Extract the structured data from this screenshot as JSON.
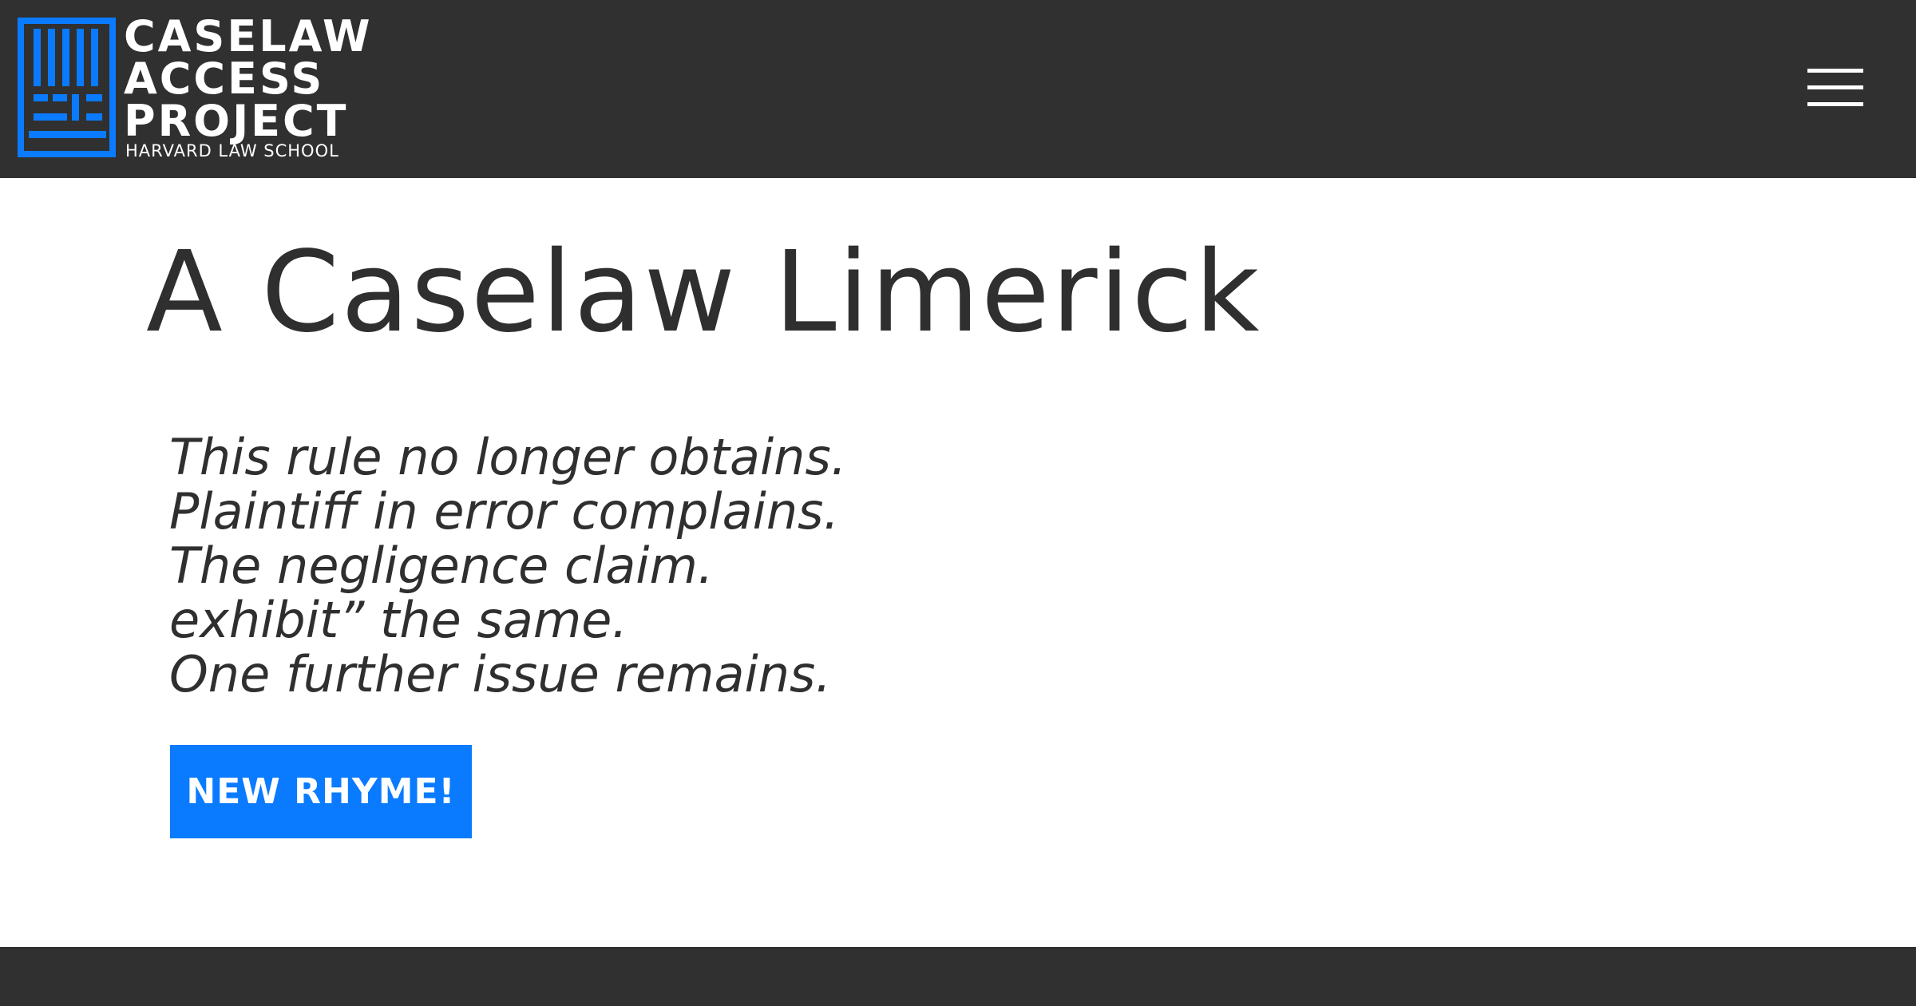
{
  "header": {
    "brand": {
      "line1": "CASELAW",
      "line2": "ACCESS",
      "line3": "PROJECT",
      "subtitle": "HARVARD LAW SCHOOL",
      "logo_icon": "cap-logo-icon",
      "logo_color": "#0a7bff"
    },
    "menu_icon": "hamburger-menu-icon",
    "background_color": "#303030"
  },
  "main": {
    "title": "A Caselaw Limerick",
    "poem": [
      "This rule no longer obtains.",
      "Plaintiff in error complains.",
      "The negligence claim.",
      "exhibit” the same.",
      "One further issue remains."
    ],
    "button_label": "NEW RHYME!",
    "button_color": "#0a7bff"
  },
  "footer": {
    "background_color": "#303030"
  }
}
